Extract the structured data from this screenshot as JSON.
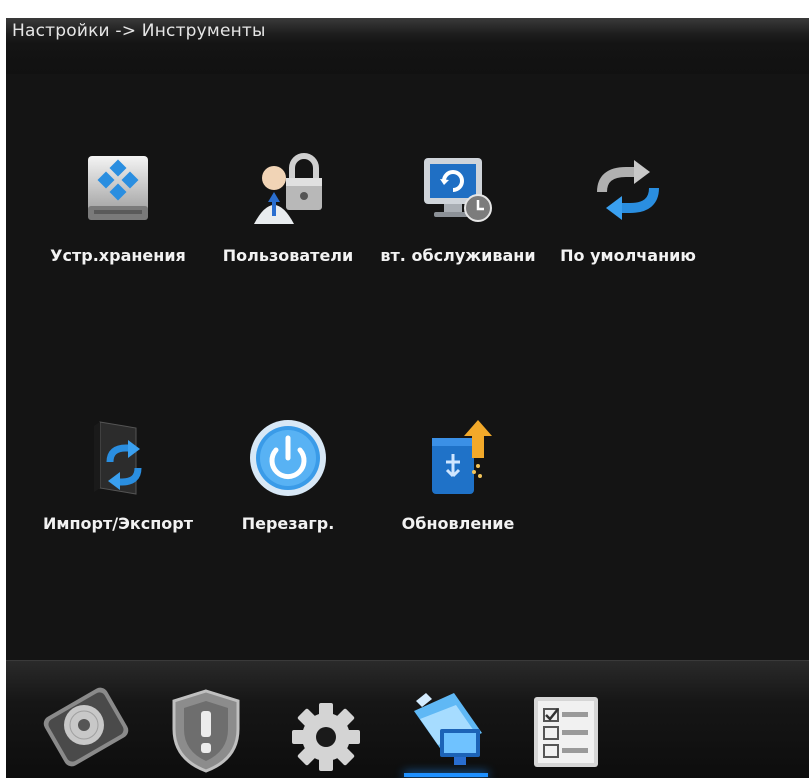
{
  "header": {
    "title": "Настройки -> Инструменты"
  },
  "tools": [
    {
      "label": "Устр.хранения",
      "icon": "storage-icon"
    },
    {
      "label": "Пользователи",
      "icon": "users-lock-icon"
    },
    {
      "label": "вт. обслуживани",
      "icon": "auto-maintenance-icon"
    },
    {
      "label": "По умолчанию",
      "icon": "defaults-reset-icon"
    },
    {
      "label": "Импорт/Экспорт",
      "icon": "import-export-icon"
    },
    {
      "label": "Перезагр.",
      "icon": "reboot-icon"
    },
    {
      "label": "Обновление",
      "icon": "update-usb-icon"
    }
  ],
  "bottom_tabs": [
    {
      "name": "disk-icon",
      "active": false
    },
    {
      "name": "alarm-shield-icon",
      "active": false
    },
    {
      "name": "settings-gear-icon",
      "active": false
    },
    {
      "name": "tools-icon",
      "active": true
    },
    {
      "name": "info-checklist-icon",
      "active": false
    }
  ],
  "colors": {
    "background": "#141414",
    "text": "#f2f2f2",
    "accent": "#1e90ff"
  }
}
